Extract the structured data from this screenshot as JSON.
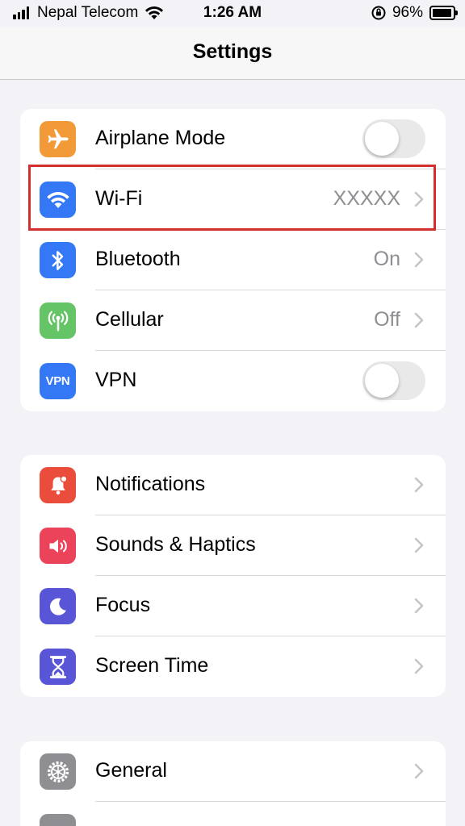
{
  "status_bar": {
    "carrier": "Nepal Telecom",
    "time": "1:26 AM",
    "battery_percent": "96%",
    "battery_level": 0.96
  },
  "nav": {
    "title": "Settings"
  },
  "groups": [
    {
      "rows": [
        {
          "label": "Airplane Mode",
          "icon": "airplane-icon",
          "icon_color": "#f19a37",
          "control": "toggle",
          "toggle_on": false
        },
        {
          "label": "Wi-Fi",
          "icon": "wifi-icon",
          "icon_color": "#3478f6",
          "value": "XXXXX",
          "control": "chevron",
          "highlighted": true
        },
        {
          "label": "Bluetooth",
          "icon": "bluetooth-icon",
          "icon_color": "#3478f6",
          "value": "On",
          "control": "chevron"
        },
        {
          "label": "Cellular",
          "icon": "cellular-antenna-icon",
          "icon_color": "#65c466",
          "value": "Off",
          "control": "chevron"
        },
        {
          "label": "VPN",
          "icon": "vpn-icon",
          "icon_text": "VPN",
          "icon_color": "#3478f6",
          "control": "toggle",
          "toggle_on": false
        }
      ]
    },
    {
      "rows": [
        {
          "label": "Notifications",
          "icon": "notifications-bell-icon",
          "icon_color": "#eb4d3d",
          "control": "chevron"
        },
        {
          "label": "Sounds & Haptics",
          "icon": "speaker-icon",
          "icon_color": "#eb445a",
          "control": "chevron"
        },
        {
          "label": "Focus",
          "icon": "moon-icon",
          "icon_color": "#5856d6",
          "control": "chevron"
        },
        {
          "label": "Screen Time",
          "icon": "hourglass-icon",
          "icon_color": "#5856d6",
          "control": "chevron"
        }
      ]
    },
    {
      "rows": [
        {
          "label": "General",
          "icon": "gear-icon",
          "icon_color": "#8e8e93",
          "control": "chevron"
        }
      ]
    }
  ],
  "colors": {
    "highlight_border": "#d32f2f",
    "background": "#f2f2f7",
    "secondary_text": "#8e8e93"
  }
}
